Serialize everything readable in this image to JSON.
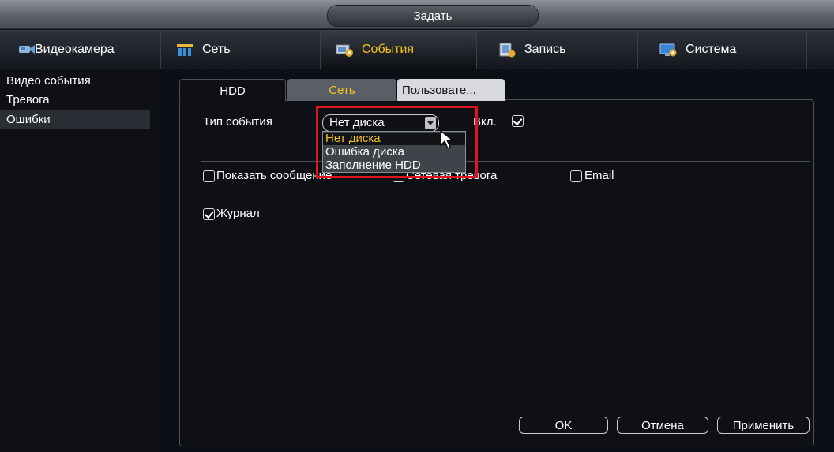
{
  "window": {
    "title": "Задать"
  },
  "main_tabs": [
    {
      "label": "Видеокамера",
      "icon": "camera-icon",
      "active": false
    },
    {
      "label": "Сеть",
      "icon": "network-icon",
      "active": false
    },
    {
      "label": "События",
      "icon": "events-icon",
      "active": true
    },
    {
      "label": "Запись",
      "icon": "record-icon",
      "active": false
    },
    {
      "label": "Система",
      "icon": "system-icon",
      "active": false
    }
  ],
  "sidebar": {
    "items": [
      {
        "label": "Видео события",
        "active": false
      },
      {
        "label": "Тревога",
        "active": false
      },
      {
        "label": "Ошибки",
        "active": true
      }
    ]
  },
  "sub_tabs": [
    {
      "label": "HDD",
      "active": true
    },
    {
      "label": "Сеть",
      "active": false
    },
    {
      "label": "Пользовате...",
      "active": false
    }
  ],
  "form": {
    "event_type_label": "Тип события",
    "event_type_value": "Нет диска",
    "enable_label": "Вкл.",
    "enable_checked": true,
    "dropdown_options": [
      "Нет диска",
      "Ошибка диска",
      "Заполнение HDD"
    ],
    "dropdown_selected": "Нет диска",
    "show_message_label": "Показать сообщение",
    "show_message_checked": false,
    "net_alarm_label": "Сетевая тревога",
    "net_alarm_checked": false,
    "email_label": "Email",
    "email_checked": false,
    "log_label": "Журнал",
    "log_checked": true
  },
  "buttons": {
    "ok": "OK",
    "cancel": "Отмена",
    "apply": "Применить"
  },
  "colors": {
    "accent": "#f5c21a",
    "highlight_box": "#e0141e"
  }
}
